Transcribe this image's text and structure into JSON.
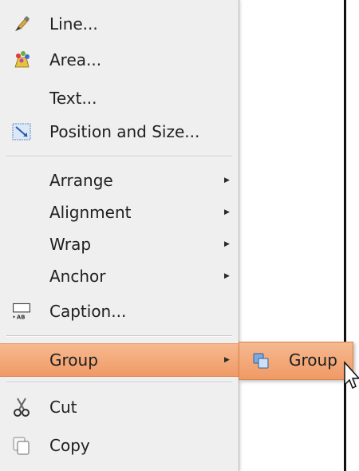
{
  "menu": {
    "items": [
      {
        "label": "Line...",
        "icon": "paintbrush-icon"
      },
      {
        "label": "Area...",
        "icon": "area-fill-icon"
      },
      {
        "label": "Text...",
        "icon": null
      },
      {
        "label": "Position and Size...",
        "icon": "position-size-icon"
      },
      {
        "label": "Arrange",
        "submenu": true
      },
      {
        "label": "Alignment",
        "submenu": true
      },
      {
        "label": "Wrap",
        "submenu": true
      },
      {
        "label": "Anchor",
        "submenu": true
      },
      {
        "label": "Caption...",
        "icon": "caption-icon"
      },
      {
        "label": "Group",
        "submenu": true,
        "highlighted": true
      },
      {
        "label": "Cut",
        "icon": "scissors-icon"
      },
      {
        "label": "Copy",
        "icon": "copy-icon"
      }
    ]
  },
  "submenu": {
    "items": [
      {
        "label": "Group",
        "icon": "group-icon",
        "highlighted": true
      }
    ]
  },
  "colors": {
    "menu_bg": "#efefef",
    "highlight": "#f4a87a",
    "page_border": "#111111"
  }
}
